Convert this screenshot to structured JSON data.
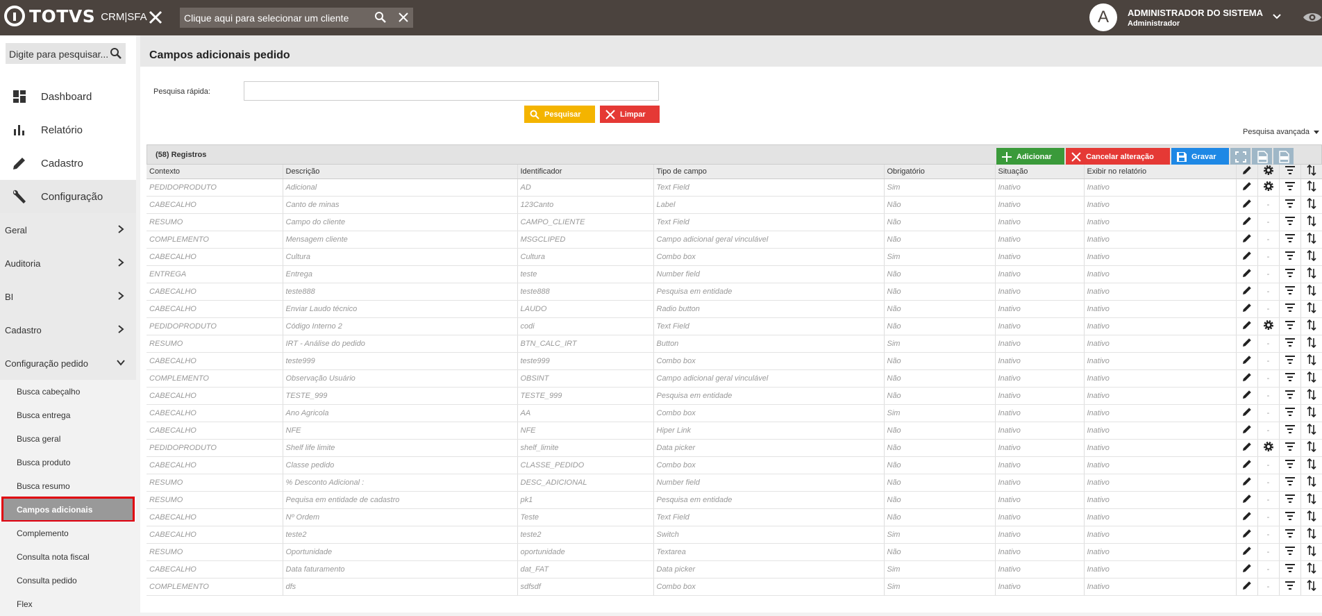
{
  "topbar": {
    "logo_text": "TOTVS",
    "logo_sub": "CRM|SFA",
    "client_search_placeholder": "Clique aqui para selecionar um cliente",
    "avatar_letter": "A",
    "user_name": "ADMINISTRADOR DO SISTEMA",
    "user_role": "Administrador",
    "bg_color": "#4b433e"
  },
  "sidebar": {
    "search_placeholder": "Digite para pesquisar...",
    "nav": [
      {
        "label": "Dashboard",
        "icon": "dashboard-icon"
      },
      {
        "label": "Relatório",
        "icon": "bar-chart-icon"
      },
      {
        "label": "Cadastro",
        "icon": "pencil-icon"
      },
      {
        "label": "Configuração",
        "icon": "wrench-icon"
      }
    ],
    "categories": [
      {
        "label": "Geral"
      },
      {
        "label": "Auditoria"
      },
      {
        "label": "BI"
      },
      {
        "label": "Cadastro"
      },
      {
        "label": "Configuração pedido"
      }
    ],
    "subitems": [
      {
        "label": "Busca cabeçalho"
      },
      {
        "label": "Busca entrega"
      },
      {
        "label": "Busca geral"
      },
      {
        "label": "Busca produto"
      },
      {
        "label": "Busca resumo"
      },
      {
        "label": "Campos adicionais"
      },
      {
        "label": "Complemento"
      },
      {
        "label": "Consulta nota fiscal"
      },
      {
        "label": "Consulta pedido"
      },
      {
        "label": "Flex"
      }
    ]
  },
  "page": {
    "title": "Campos adicionais pedido",
    "quick_search_label": "Pesquisa rápida:",
    "search_button": "Pesquisar",
    "clear_button": "Limpar",
    "advanced_search": "Pesquisa avançada",
    "records": "(58) Registros",
    "add_button": "Adicionar",
    "cancel_button": "Cancelar alteração",
    "save_button": "Gravar"
  },
  "table": {
    "columns": [
      "Contexto",
      "Descrição",
      "Identificador",
      "Tipo de campo",
      "Obrigatório",
      "Situação",
      "Exibir no relatório"
    ],
    "rows": [
      [
        "PEDIDOPRODUTO",
        "Adicional",
        "AD",
        "Text Field",
        "Sim",
        "Inativo",
        "Inativo",
        "gear"
      ],
      [
        "CABECALHO",
        "Canto de minas",
        "123Canto",
        "Label",
        "Não",
        "Inativo",
        "Inativo",
        "-"
      ],
      [
        "RESUMO",
        "Campo do cliente",
        "CAMPO_CLIENTE",
        "Text Field",
        "Não",
        "Inativo",
        "Inativo",
        "-"
      ],
      [
        "COMPLEMENTO",
        "Mensagem cliente",
        "MSGCLIPED",
        "Campo adicional geral vinculável",
        "Não",
        "Inativo",
        "Inativo",
        "-"
      ],
      [
        "CABECALHO",
        "Cultura",
        "Cultura",
        "Combo box",
        "Sim",
        "Inativo",
        "Inativo",
        "-"
      ],
      [
        "ENTREGA",
        "Entrega",
        "teste",
        "Number field",
        "Não",
        "Inativo",
        "Inativo",
        "-"
      ],
      [
        "CABECALHO",
        "teste888",
        "teste888",
        "Pesquisa em entidade",
        "Não",
        "Inativo",
        "Inativo",
        "-"
      ],
      [
        "CABECALHO",
        "Enviar Laudo técnico",
        "LAUDO",
        "Radio button",
        "Não",
        "Inativo",
        "Inativo",
        "-"
      ],
      [
        "PEDIDOPRODUTO",
        "Código Interno 2",
        "codi",
        "Text Field",
        "Não",
        "Inativo",
        "Inativo",
        "gear"
      ],
      [
        "RESUMO",
        "IRT - Análise do pedido",
        "BTN_CALC_IRT",
        "Button",
        "Sim",
        "Inativo",
        "Inativo",
        "-"
      ],
      [
        "CABECALHO",
        "teste999",
        "teste999",
        "Combo box",
        "Não",
        "Inativo",
        "Inativo",
        "-"
      ],
      [
        "COMPLEMENTO",
        "Observação Usuário",
        "OBSINT",
        "Campo adicional geral vinculável",
        "Não",
        "Inativo",
        "Inativo",
        "-"
      ],
      [
        "CABECALHO",
        "TESTE_999",
        "TESTE_999",
        "Pesquisa em entidade",
        "Não",
        "Inativo",
        "Inativo",
        "-"
      ],
      [
        "CABECALHO",
        "Ano Agricola",
        "AA",
        "Combo box",
        "Sim",
        "Inativo",
        "Inativo",
        "-"
      ],
      [
        "CABECALHO",
        "NFE",
        "NFE",
        "Hiper Link",
        "Não",
        "Inativo",
        "Inativo",
        "-"
      ],
      [
        "PEDIDOPRODUTO",
        "Shelf life limite",
        "shelf_limite",
        "Data picker",
        "Não",
        "Inativo",
        "Inativo",
        "gear"
      ],
      [
        "CABECALHO",
        "Classe pedido",
        "CLASSE_PEDIDO",
        "Combo box",
        "Não",
        "Inativo",
        "Inativo",
        "-"
      ],
      [
        "RESUMO",
        "% Desconto Adicional :",
        "DESC_ADICIONAL",
        "Number field",
        "Não",
        "Inativo",
        "Inativo",
        "-"
      ],
      [
        "RESUMO",
        "Pequisa em entidade de cadastro",
        "pk1",
        "Pesquisa em entidade",
        "Não",
        "Inativo",
        "Inativo",
        "-"
      ],
      [
        "CABECALHO",
        "Nº Ordem",
        "Teste",
        "Text Field",
        "Não",
        "Inativo",
        "Inativo",
        "-"
      ],
      [
        "CABECALHO",
        "teste2",
        "teste2",
        "Switch",
        "Sim",
        "Inativo",
        "Inativo",
        "-"
      ],
      [
        "RESUMO",
        "Oportunidade",
        "oportunidade",
        "Textarea",
        "Não",
        "Inativo",
        "Inativo",
        "-"
      ],
      [
        "CABECALHO",
        "Data faturamento",
        "dat_FAT",
        "Data picker",
        "Sim",
        "Inativo",
        "Inativo",
        "-"
      ],
      [
        "COMPLEMENTO",
        "dfs",
        "sdfsdf",
        "Combo box",
        "Sim",
        "Inativo",
        "Inativo",
        "-"
      ]
    ]
  }
}
